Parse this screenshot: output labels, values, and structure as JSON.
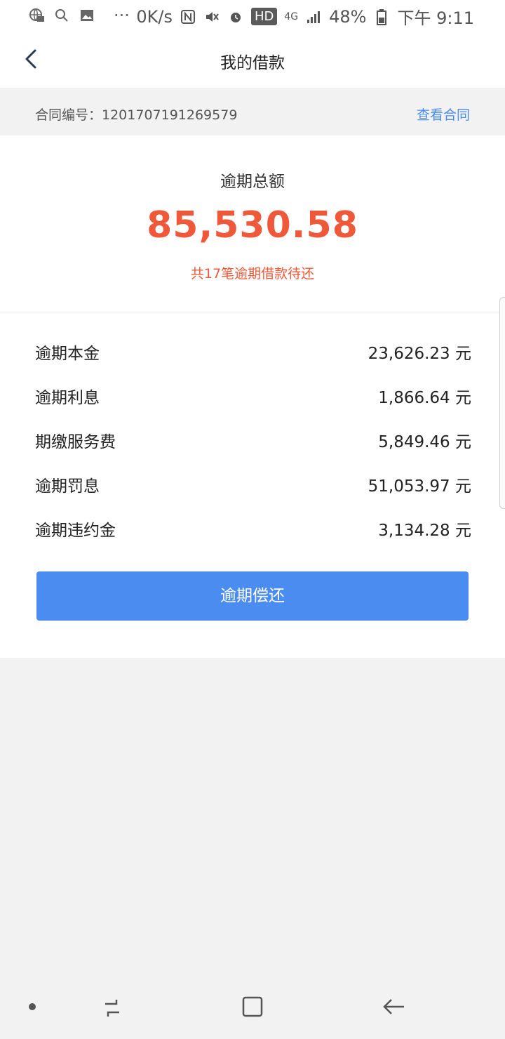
{
  "status_bar": {
    "speed": "0K/s",
    "network": "4G",
    "hd": "HD",
    "battery": "48%",
    "time": "下午 9:11",
    "more": "···"
  },
  "header": {
    "title": "我的借款",
    "back_icon": "chevron-left-icon"
  },
  "contract": {
    "label": "合同编号：1201707191269579",
    "link": "查看合同"
  },
  "summary": {
    "title": "逾期总额",
    "amount": "85,530.58",
    "note": "共17笔逾期借款待还"
  },
  "details": [
    {
      "label": "逾期本金",
      "value": "23,626.23 元"
    },
    {
      "label": "逾期利息",
      "value": "1,866.64 元"
    },
    {
      "label": "期缴服务费",
      "value": "5,849.46 元"
    },
    {
      "label": "逾期罚息",
      "value": "51,053.97 元"
    },
    {
      "label": "逾期违约金",
      "value": "3,134.28 元"
    }
  ],
  "action": {
    "label": "逾期偿还"
  },
  "colors": {
    "accent_red": "#f0583a",
    "primary_blue": "#4a8cf0",
    "link_blue": "#4a8cf0"
  }
}
